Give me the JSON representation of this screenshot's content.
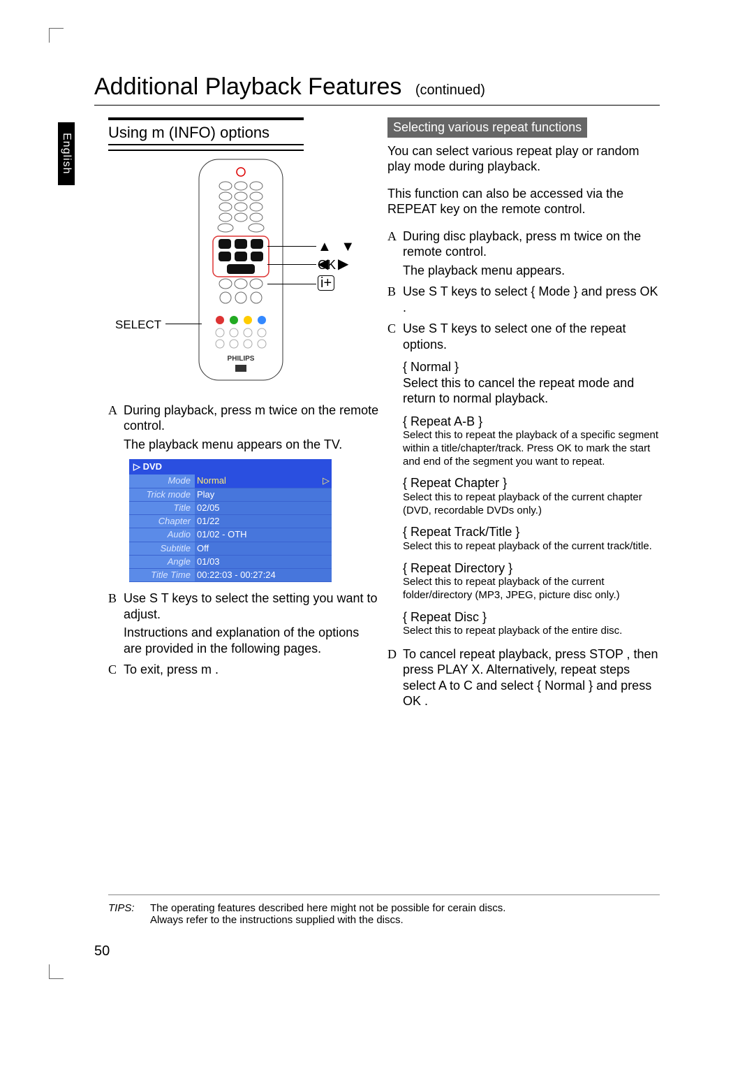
{
  "language_tab": "English",
  "title": "Additional Playback Features",
  "continued": "(continued)",
  "page_number": "50",
  "left": {
    "section_heading": "Using m (INFO) options",
    "remote_labels": {
      "arrows": "▲ ▼ ◀ ▶",
      "ok": "OK",
      "info": "i+",
      "select": "SELECT"
    },
    "step_a": "During playback, press m twice on the remote control.",
    "step_a_result": "The playback menu appears on the TV.",
    "osd": {
      "title_prefix": "▷",
      "title": "DVD",
      "rows": [
        {
          "label": "Mode",
          "value": "Normal",
          "selected": true
        },
        {
          "label": "Trick mode",
          "value": "Play"
        },
        {
          "label": "Title",
          "value": "02/05"
        },
        {
          "label": "Chapter",
          "value": "01/22"
        },
        {
          "label": "Audio",
          "value": "01/02 - OTH"
        },
        {
          "label": "Subtitle",
          "value": "Off"
        },
        {
          "label": "Angle",
          "value": "01/03"
        },
        {
          "label": "Title Time",
          "value": "00:22:03 - 00:27:24"
        }
      ]
    },
    "step_b": "Use S T keys to select the setting you want to adjust.",
    "step_b_result": "Instructions and explanation of the options are provided in the following pages.",
    "step_c": "To exit, press m ."
  },
  "right": {
    "grey_heading": "Selecting various repeat functions",
    "intro1": "You can select various repeat play or random play mode during playback.",
    "intro2": "This function can also be accessed via the REPEAT key on the remote control.",
    "step_a": "During disc playback, press m twice on the remote control.",
    "step_a_result": "The playback menu appears.",
    "step_b": "Use S T keys to select { Mode } and press OK .",
    "step_c": "Use S T keys to select one of the repeat options.",
    "options": [
      {
        "name": "{ Normal  }",
        "desc": "Select this to cancel the repeat mode and return to normal playback.",
        "big": true
      },
      {
        "name": "{ Repeat A-B  }",
        "desc": "Select this to repeat the playback of a specific segment within a title/chapter/track. Press OK to mark the start and end of the segment you want to repeat."
      },
      {
        "name": "{ Repeat Chapter  }",
        "desc": "Select this to repeat playback of the current chapter (DVD, recordable DVDs only.)"
      },
      {
        "name": "{ Repeat Track/Title   }",
        "desc": "Select this to repeat playback of the current track/title."
      },
      {
        "name": "{ Repeat Directory   }",
        "desc": "Select this to repeat playback of the current folder/directory (MP3, JPEG, picture disc only.)"
      },
      {
        "name": "{ Repeat Disc }",
        "desc": "Select this to repeat playback of the entire disc."
      }
    ],
    "step_d": "To cancel repeat playback, press STOP , then press PLAY  X. Alternatively, repeat steps select A to C and select { Normal  } and press OK ."
  },
  "tips": {
    "label": "TIPS:",
    "line1": "The operating features described here might not be possible for cerain discs.",
    "line2": "Always refer to the instructions supplied with the discs."
  }
}
